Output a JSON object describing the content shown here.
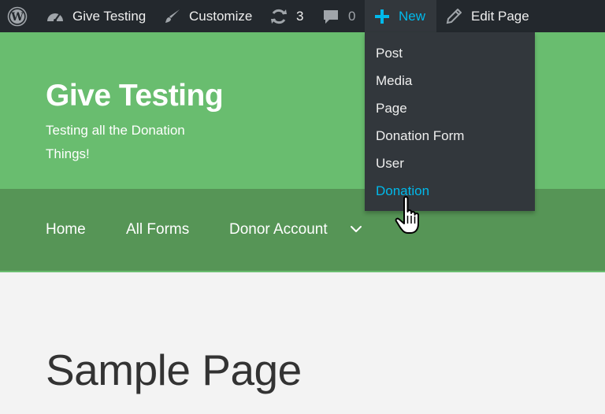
{
  "admin_bar": {
    "wp_logo_icon": "wordpress-icon",
    "site_name": "Give Testing",
    "customize_label": "Customize",
    "updates_count": "3",
    "comments_count": "0",
    "new_label": "New",
    "edit_label": "Edit Page"
  },
  "new_menu": {
    "items": [
      "Post",
      "Media",
      "Page",
      "Donation Form",
      "User",
      "Donation"
    ],
    "highlighted": "Donation"
  },
  "site": {
    "title": "Give Testing",
    "tagline": "Testing all the Donation Things!"
  },
  "nav": {
    "items": [
      "Home",
      "All Forms",
      "Donor Account"
    ]
  },
  "page": {
    "title": "Sample Page"
  },
  "colors": {
    "admin_bar_bg": "#23282d",
    "accent_blue": "#00b9eb",
    "header_green": "#69bd6f",
    "nav_green": "#569556",
    "content_bg": "#f3f3f3"
  }
}
